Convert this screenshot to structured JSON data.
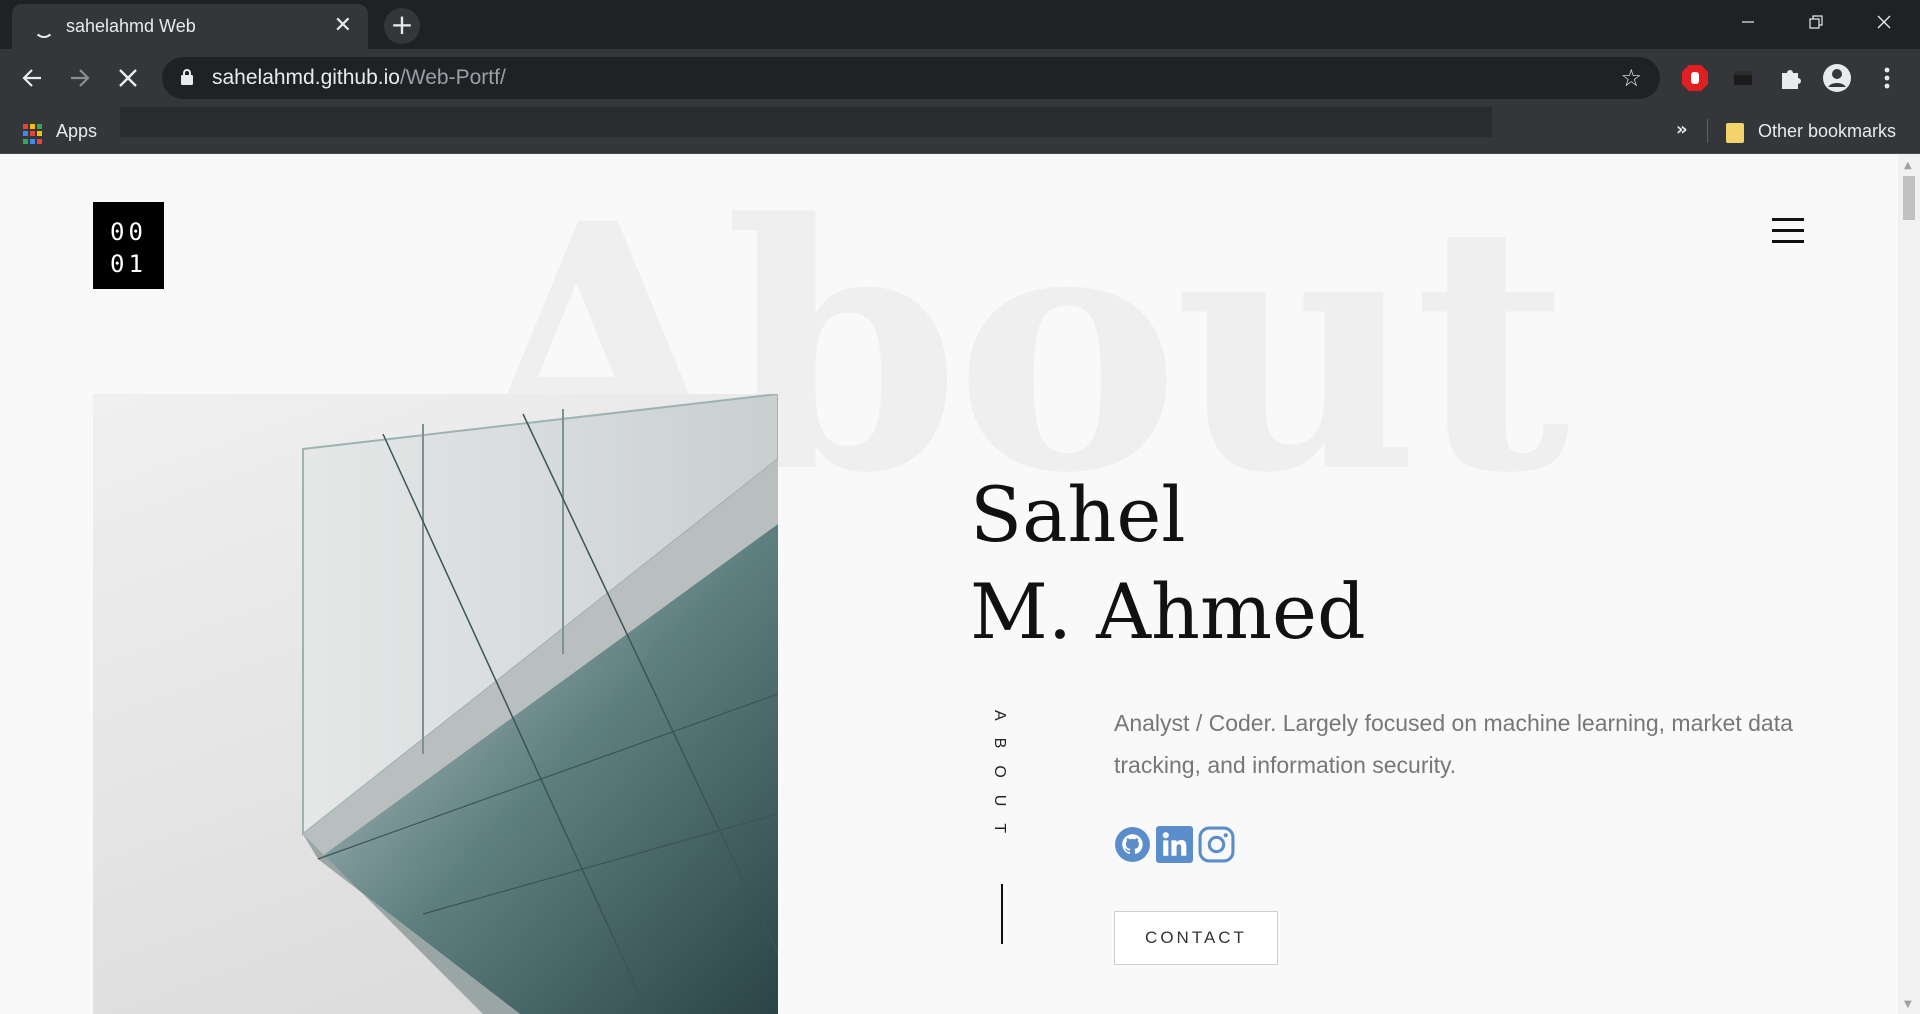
{
  "browser": {
    "tab_title": "sahelahmd Web",
    "url_host": "sahelahmd.github.io",
    "url_path": "/Web-Portf/",
    "bookmarks_apps": "Apps",
    "bookmarks_other": "Other bookmarks",
    "chevron": "»"
  },
  "page": {
    "logo_line1": "00",
    "logo_line2": "01",
    "background_word": "About",
    "name_line1": "Sahel",
    "name_line2": "M. Ahmed",
    "section_label": "ABOUT",
    "description": "Analyst / Coder. Largely focused on machine learning, market data tracking, and information security.",
    "contact_label": "CONTACT"
  },
  "icons": {
    "social": [
      "github-icon",
      "linkedin-icon",
      "instagram-icon"
    ],
    "social_color": "#5a8dc9"
  },
  "colors": {
    "chrome_dark": "#202124",
    "chrome_toolbar": "#35363a",
    "page_bg": "#f9f9f9",
    "accent_blue": "#5a8dc9"
  }
}
